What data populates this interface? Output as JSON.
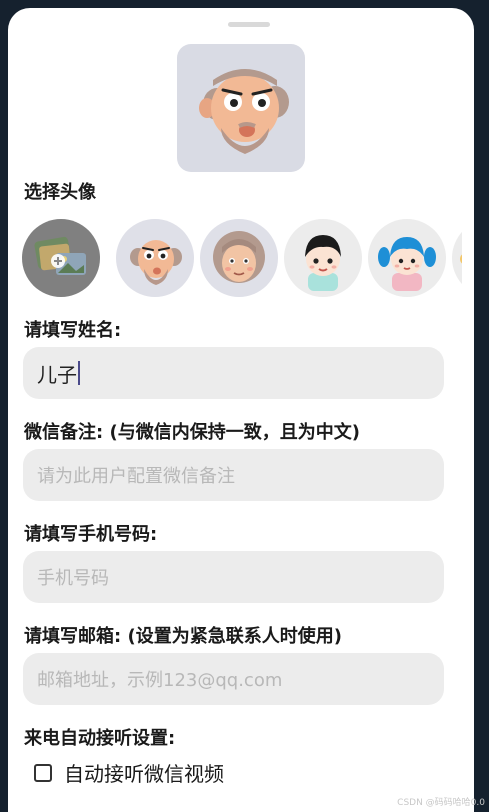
{
  "avatar_section": {
    "label": "选择头像",
    "options": [
      {
        "name": "upload-photo-option"
      },
      {
        "name": "grandpa-option"
      },
      {
        "name": "grandma-option"
      },
      {
        "name": "boy-option"
      },
      {
        "name": "girl-option"
      }
    ]
  },
  "form": {
    "name": {
      "label": "请填写姓名:",
      "value": "儿子"
    },
    "wechat_note": {
      "label": "微信备注: (与微信内保持一致，且为中文)",
      "placeholder": "请为此用户配置微信备注"
    },
    "phone": {
      "label": "请填写手机号码:",
      "placeholder": "手机号码"
    },
    "email": {
      "label": "请填写邮箱: (设置为紧急联系人时使用)",
      "placeholder": "邮箱地址，示例123@qq.com"
    },
    "call_settings": {
      "label": "来电自动接听设置:"
    },
    "auto_answer": {
      "label": "自动接听微信视频",
      "checked": false
    }
  },
  "watermark": "CSDN @码码哈哈0.0"
}
